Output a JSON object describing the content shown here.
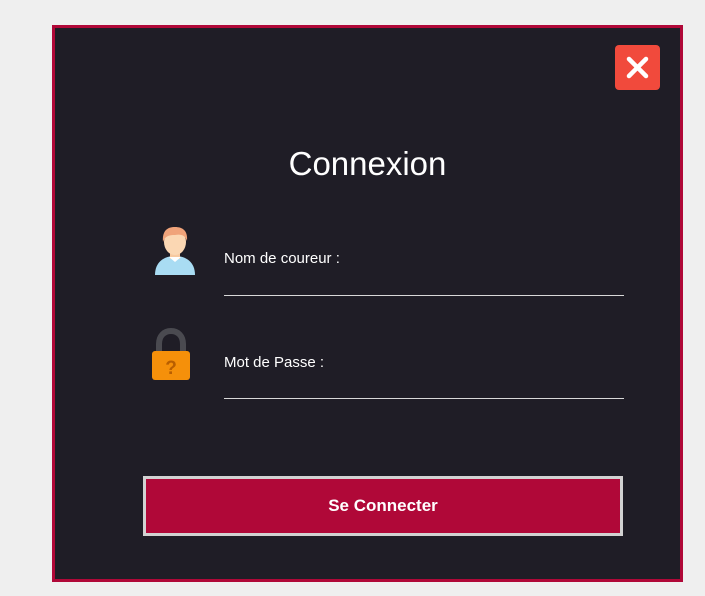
{
  "dialog": {
    "title": "Connexion",
    "close_icon": "close-icon",
    "fields": {
      "username": {
        "label": "Nom de coureur :",
        "value": "",
        "icon": "user-icon"
      },
      "password": {
        "label": "Mot de Passe :",
        "value": "",
        "icon": "lock-icon"
      }
    },
    "submit_label": "Se Connecter"
  },
  "colors": {
    "page_background": "#efefef",
    "dialog_background": "#1f1d26",
    "accent": "#b00838",
    "close_button": "#f14a3c",
    "lock_icon": "#f5900a",
    "text": "#ffffff"
  }
}
